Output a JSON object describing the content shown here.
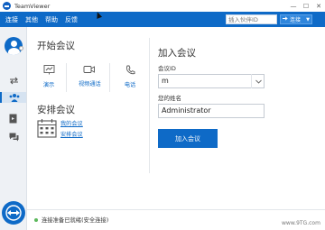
{
  "window": {
    "title": "TeamViewer",
    "controls": {
      "minimize": "—",
      "maximize": "☐",
      "close": "✕"
    }
  },
  "menu": {
    "items": [
      "连接",
      "其他",
      "帮助",
      "反馈"
    ]
  },
  "toolbar": {
    "partner_id_placeholder": "插入伙伴ID",
    "connect_label": "连接",
    "connect_chevron": "▼"
  },
  "sidebar": {
    "icons": [
      "remote-control-icon",
      "meeting-icon",
      "computers-contacts-icon",
      "chat-icon"
    ],
    "active": "meeting-icon"
  },
  "start_meeting": {
    "title": "开始会议",
    "tiles": [
      {
        "label": "演示",
        "icon": "presentation-icon"
      },
      {
        "label": "视频通话",
        "icon": "video-call-icon"
      },
      {
        "label": "电话",
        "icon": "phone-icon"
      }
    ]
  },
  "schedule_meeting": {
    "title": "安排会议",
    "links": [
      "我的会议",
      "安排会议"
    ]
  },
  "join_meeting": {
    "title": "加入会议",
    "meeting_id_label": "会议ID",
    "meeting_id_value": "m",
    "name_label": "您的姓名",
    "name_value": "Administrator",
    "join_button": "加入会议"
  },
  "status": {
    "text": "连接准备已就绪(安全连接)",
    "color": "#5cb85c"
  },
  "watermark": "www.9TG.com",
  "colors": {
    "accent": "#0e6ac7",
    "menubar": "#0e6ac7",
    "sidebar": "#eef1f5"
  }
}
